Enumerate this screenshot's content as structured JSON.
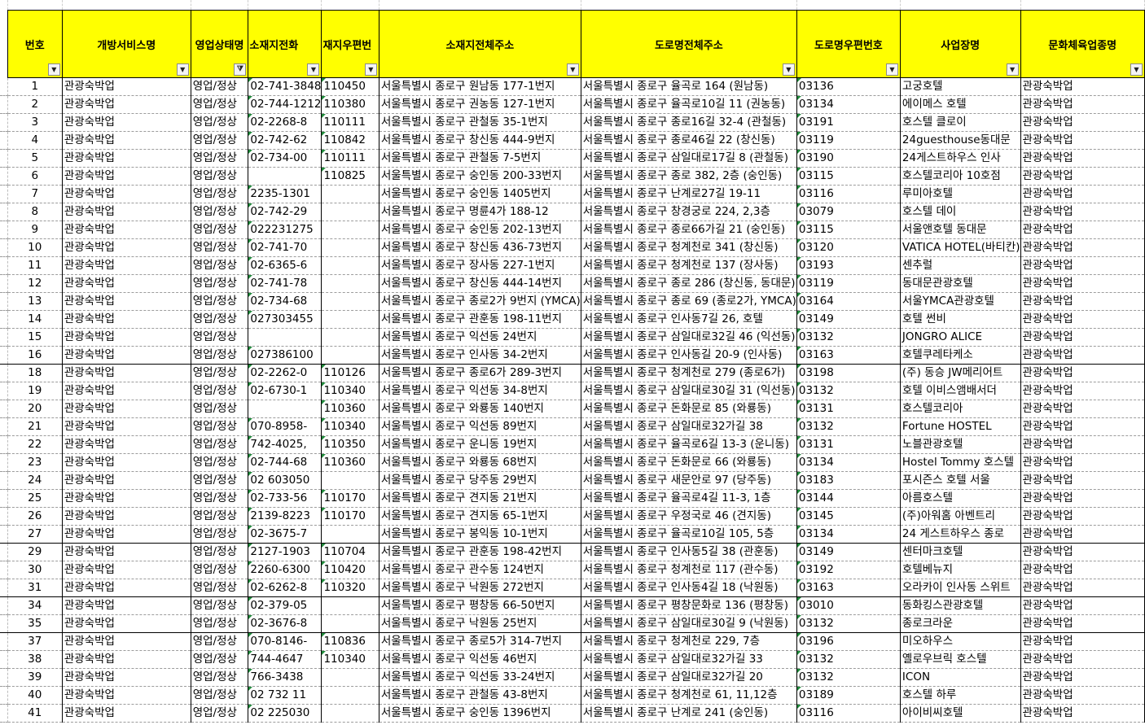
{
  "sheet": {
    "headers": [
      {
        "label": "번호"
      },
      {
        "label": "개방서비스명"
      },
      {
        "label": "영업상태명"
      },
      {
        "label": "소재지전화"
      },
      {
        "label": "재지우편번"
      },
      {
        "label": "소재지전체주소"
      },
      {
        "label": "도로명전체주소"
      },
      {
        "label": "도로명우편번호"
      },
      {
        "label": "사업장명"
      },
      {
        "label": "문화체육업종명"
      }
    ],
    "filter_icon": "dropdown-arrow-icon",
    "active_filter_icon": "filter-funnel-icon",
    "colors": {
      "header_bg": "#ffff00",
      "grid": "#000000",
      "error_marker": "#1f8a3a"
    },
    "rows": [
      [
        "1",
        "관광숙박업",
        "영업/정상",
        "02-741-3848",
        "110450",
        "서울특별시 종로구 원남동 177-1번지",
        "서울특별시 종로구 율곡로 164 (원남동)",
        "03136",
        "고궁호텔",
        "관광숙박업"
      ],
      [
        "2",
        "관광숙박업",
        "영업/정상",
        "02-744-1212",
        "110380",
        "서울특별시 종로구 권농동 127-1번지",
        "서울특별시 종로구 율곡로10길 11 (권농동)",
        "03134",
        "에이메스 호텔",
        "관광숙박업"
      ],
      [
        "3",
        "관광숙박업",
        "영업/정상",
        "02-2268-8",
        "110111",
        "서울특별시 종로구 관철동 35-1번지",
        "서울특별시 종로구 종로16길 32-4 (관철동)",
        "03191",
        "호스텔 클로이",
        "관광숙박업"
      ],
      [
        "4",
        "관광숙박업",
        "영업/정상",
        "02-742-62",
        "110842",
        "서울특별시 종로구 창신동 444-9번지",
        "서울특별시 종로구 종로46길 22 (창신동)",
        "03119",
        "24guesthouse동대문",
        "관광숙박업"
      ],
      [
        "5",
        "관광숙박업",
        "영업/정상",
        "02-734-00",
        "110111",
        "서울특별시 종로구 관철동 7-5번지",
        "서울특별시 종로구 삼일대로17길 8 (관철동)",
        "03190",
        "24게스트하우스 인사",
        "관광숙박업"
      ],
      [
        "6",
        "관광숙박업",
        "영업/정상",
        "",
        "110825",
        "서울특별시 종로구 숭인동 200-33번지",
        "서울특별시 종로구 종로 382, 2층 (숭인동)",
        "03115",
        "호스텔코리아 10호점",
        "관광숙박업"
      ],
      [
        "7",
        "관광숙박업",
        "영업/정상",
        "2235-1301",
        "",
        "서울특별시 종로구 숭인동 1405번지",
        "서울특별시 종로구 난계로27길 19-11",
        "03116",
        "루미아호텔",
        "관광숙박업"
      ],
      [
        "8",
        "관광숙박업",
        "영업/정상",
        "02-742-29",
        "",
        "서울특별시 종로구 명륜4가 188-12",
        "서울특별시 종로구 창경궁로 224, 2,3층",
        "03079",
        "호스텔 데이",
        "관광숙박업"
      ],
      [
        "9",
        "관광숙박업",
        "영업/정상",
        "022231275",
        "",
        "서울특별시 종로구 숭인동 202-13번지",
        "서울특별시 종로구 종로66가길 21 (숭인동)",
        "03115",
        "서울앤호텔 동대문",
        "관광숙박업"
      ],
      [
        "10",
        "관광숙박업",
        "영업/정상",
        "02-741-70",
        "",
        "서울특별시 종로구 창신동 436-73번지",
        "서울특별시 종로구 청계천로 341 (창신동)",
        "03120",
        "VATICA HOTEL(바티칸)",
        "관광숙박업"
      ],
      [
        "11",
        "관광숙박업",
        "영업/정상",
        "02-6365-6",
        "",
        "서울특별시 종로구 장사동 227-1번지",
        "서울특별시 종로구 청계천로 137 (장사동)",
        "03193",
        "센추럴",
        "관광숙박업"
      ],
      [
        "12",
        "관광숙박업",
        "영업/정상",
        "02-741-78",
        "",
        "서울특별시 종로구 창신동 444-14번지",
        "서울특별시 종로구 종로 286 (창신동, 동대문)",
        "03119",
        "동대문관광호텔",
        "관광숙박업"
      ],
      [
        "13",
        "관광숙박업",
        "영업/정상",
        "02-734-68",
        "",
        "서울특별시 종로구 종로2가 9번지 (YMCA)",
        "서울특별시 종로구 종로 69 (종로2가, YMCA)",
        "03164",
        "서울YMCA관광호텔",
        "관광숙박업"
      ],
      [
        "14",
        "관광숙박업",
        "영업/정상",
        "027303455",
        "",
        "서울특별시 종로구 관훈동 198-11번지",
        "서울특별시 종로구 인사동7길 26, 호텔",
        "03149",
        "호텔 썬비",
        "관광숙박업"
      ],
      [
        "15",
        "관광숙박업",
        "영업/정상",
        "",
        "",
        "서울특별시 종로구 익선동 24번지",
        "서울특별시 종로구 삼일대로32길 46 (익선동)",
        "03132",
        "JONGRO ALICE",
        "관광숙박업"
      ],
      [
        "16",
        "관광숙박업",
        "영업/정상",
        "027386100",
        "",
        "서울특별시 종로구 인사동 34-2번지",
        "서울특별시 종로구 인사동길 20-9 (인사동)",
        "03163",
        "호텔쿠레타케소",
        "관광숙박업"
      ],
      [
        "18",
        "관광숙박업",
        "영업/정상",
        "02-2262-0",
        "110126",
        "서울특별시 종로구 종로6가 289-3번지",
        "서울특별시 종로구 청계천로 279 (종로6가)",
        "03198",
        "(주) 동승 JW메리어트",
        "관광숙박업"
      ],
      [
        "19",
        "관광숙박업",
        "영업/정상",
        "02-6730-1",
        "110340",
        "서울특별시 종로구 익선동 34-8번지",
        "서울특별시 종로구 삼일대로30길 31 (익선동)",
        "03132",
        "호텔 이비스앰배서더",
        "관광숙박업"
      ],
      [
        "20",
        "관광숙박업",
        "영업/정상",
        "",
        "110360",
        "서울특별시 종로구 와룡동 140번지",
        "서울특별시 종로구 돈화문로 85 (와룡동)",
        "03131",
        "호스텔코리아",
        "관광숙박업"
      ],
      [
        "21",
        "관광숙박업",
        "영업/정상",
        "070-8958-",
        "110340",
        "서울특별시 종로구 익선동 89번지",
        "서울특별시 종로구 삼일대로32가길 38",
        "03132",
        "Fortune HOSTEL",
        "관광숙박업"
      ],
      [
        "22",
        "관광숙박업",
        "영업/정상",
        "742-4025,",
        "110350",
        "서울특별시 종로구 운니동 19번지",
        "서울특별시 종로구 율곡로6길 13-3 (운니동)",
        "03131",
        "노블관광호텔",
        "관광숙박업"
      ],
      [
        "23",
        "관광숙박업",
        "영업/정상",
        "02-744-68",
        "110360",
        "서울특별시 종로구 와룡동 68번지",
        "서울특별시 종로구 돈화문로 66 (와룡동)",
        "03134",
        "Hostel Tommy 호스텔",
        "관광숙박업"
      ],
      [
        "24",
        "관광숙박업",
        "영업/정상",
        "02  603050",
        "",
        "서울특별시 종로구 당주동 29번지",
        "서울특별시 종로구 새문안로 97 (당주동)",
        "03183",
        "포시즌스 호텔 서울",
        "관광숙박업"
      ],
      [
        "25",
        "관광숙박업",
        "영업/정상",
        "02-733-56",
        "110170",
        "서울특별시 종로구 견지동 21번지",
        "서울특별시 종로구 율곡로4길 11-3, 1층",
        "03144",
        "아름호스텔",
        "관광숙박업"
      ],
      [
        "26",
        "관광숙박업",
        "영업/정상",
        "2139-8223",
        "110170",
        "서울특별시 종로구 견지동 65-1번지",
        "서울특별시 종로구 우정국로 46 (견지동)",
        "03145",
        "(주)아워홈 아벤트리",
        "관광숙박업"
      ],
      [
        "27",
        "관광숙박업",
        "영업/정상",
        "02-3675-7",
        "",
        "서울특별시 종로구 봉익동 10-1번지",
        "서울특별시 종로구 율곡로10길 105, 5층",
        "03134",
        "24 게스트하우스 종로",
        "관광숙박업"
      ],
      [
        "29",
        "관광숙박업",
        "영업/정상",
        "2127-1903",
        "110704",
        "서울특별시 종로구 관훈동 198-42번지",
        "서울특별시 종로구 인사동5길 38 (관훈동)",
        "03149",
        "센터마크호텔",
        "관광숙박업"
      ],
      [
        "30",
        "관광숙박업",
        "영업/정상",
        "2260-6300",
        "110420",
        "서울특별시 종로구 관수동 124번지",
        "서울특별시 종로구 청계천로 117 (관수동)",
        "03192",
        "호텔베뉴지",
        "관광숙박업"
      ],
      [
        "31",
        "관광숙박업",
        "영업/정상",
        "02-6262-8",
        "110320",
        "서울특별시 종로구 낙원동 272번지",
        "서울특별시 종로구 인사동4길 18 (낙원동)",
        "03163",
        "오라카이 인사동 스위트",
        "관광숙박업"
      ],
      [
        "34",
        "관광숙박업",
        "영업/정상",
        "02-379-05",
        "",
        "서울특별시 종로구 평창동 66-50번지",
        "서울특별시 종로구 평창문화로 136 (평창동)",
        "03010",
        "동화킹스관광호텔",
        "관광숙박업"
      ],
      [
        "35",
        "관광숙박업",
        "영업/정상",
        "02-3676-8",
        "",
        "서울특별시 종로구 낙원동 25번지",
        "서울특별시 종로구 삼일대로30길 9 (낙원동)",
        "03132",
        "종로크라운",
        "관광숙박업"
      ],
      [
        "37",
        "관광숙박업",
        "영업/정상",
        "070-8146-",
        "110836",
        "서울특별시 종로구 종로5가 314-7번지",
        "서울특별시 종로구 청계천로 229, 7층",
        "03196",
        "미오하우스",
        "관광숙박업"
      ],
      [
        "38",
        "관광숙박업",
        "영업/정상",
        "744-4647",
        "110340",
        "서울특별시 종로구 익선동 46번지",
        "서울특별시 종로구 삼일대로32가길 33",
        "03132",
        "옐로우브릭 호스텔",
        "관광숙박업"
      ],
      [
        "39",
        "관광숙박업",
        "영업/정상",
        "766-3438",
        "",
        "서울특별시 종로구 익선동 33-24번지",
        "서울특별시 종로구 삼일대로32가길 20",
        "03132",
        "ICON",
        "관광숙박업"
      ],
      [
        "40",
        "관광숙박업",
        "영업/정상",
        "02  732 11",
        "",
        "서울특별시 종로구 관철동 43-8번지",
        "서울특별시 종로구 청계천로 61, 11,12층",
        "03189",
        "호스텔 하루",
        "관광숙박업"
      ],
      [
        "41",
        "관광숙박업",
        "영업/정상",
        "02  225030",
        "",
        "서울특별시 종로구 숭인동 1396번지",
        "서울특별시 종로구 난계로 241 (숭인동)",
        "03116",
        "아이비씨호텔",
        "관광숙박업"
      ]
    ]
  }
}
